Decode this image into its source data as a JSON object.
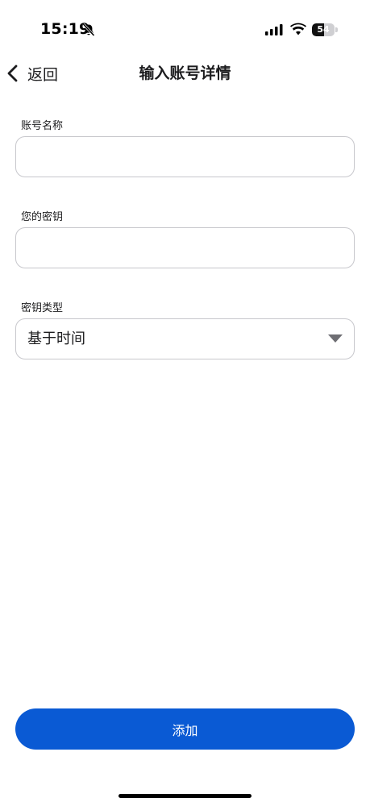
{
  "status_bar": {
    "time": "15:19",
    "battery_level": "54",
    "icons": [
      "bell-slash-icon",
      "signal-icon",
      "wifi-icon",
      "battery-icon"
    ]
  },
  "nav": {
    "back_label": "返回",
    "title": "输入账号详情",
    "back_icon": "chevron-left-icon"
  },
  "form": {
    "account_name": {
      "label": "账号名称",
      "value": "",
      "placeholder": ""
    },
    "secret_key": {
      "label": "您的密钥",
      "value": "",
      "placeholder": ""
    },
    "key_type": {
      "label": "密钥类型",
      "selected": "基于时间",
      "icon": "caret-down-icon"
    }
  },
  "actions": {
    "add_label": "添加"
  },
  "colors": {
    "primary": "#0a5ad4",
    "border": "#c7c7cc",
    "text": "#1c1c1e"
  }
}
